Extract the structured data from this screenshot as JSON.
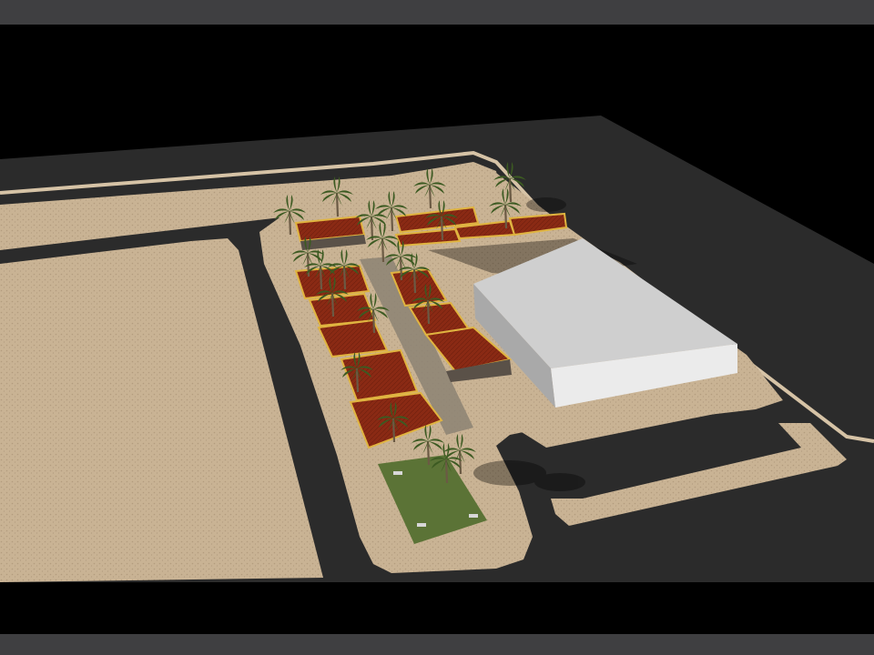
{
  "scene": {
    "kind": "3d-site-plan-render",
    "letterbox_color": "#3f3f41",
    "background_color": "#000000",
    "colors": {
      "asphalt": "#2b2b2b",
      "sand": "#c9b394",
      "sand_dark": "#b39c7e",
      "curb": "#d6c3a6",
      "building_roof": "#cfcfcf",
      "building_wall": "#ebebeb",
      "building_shadow_wall": "#a9a9a9",
      "terrace_deck": "#8a2a14",
      "terrace_border": "#e0b440",
      "grass": "#5b7336",
      "palm_frond": "#3c5a22",
      "palm_trunk": "#6b5a44",
      "walkway": "#8c8273"
    },
    "palm_count": 26
  }
}
